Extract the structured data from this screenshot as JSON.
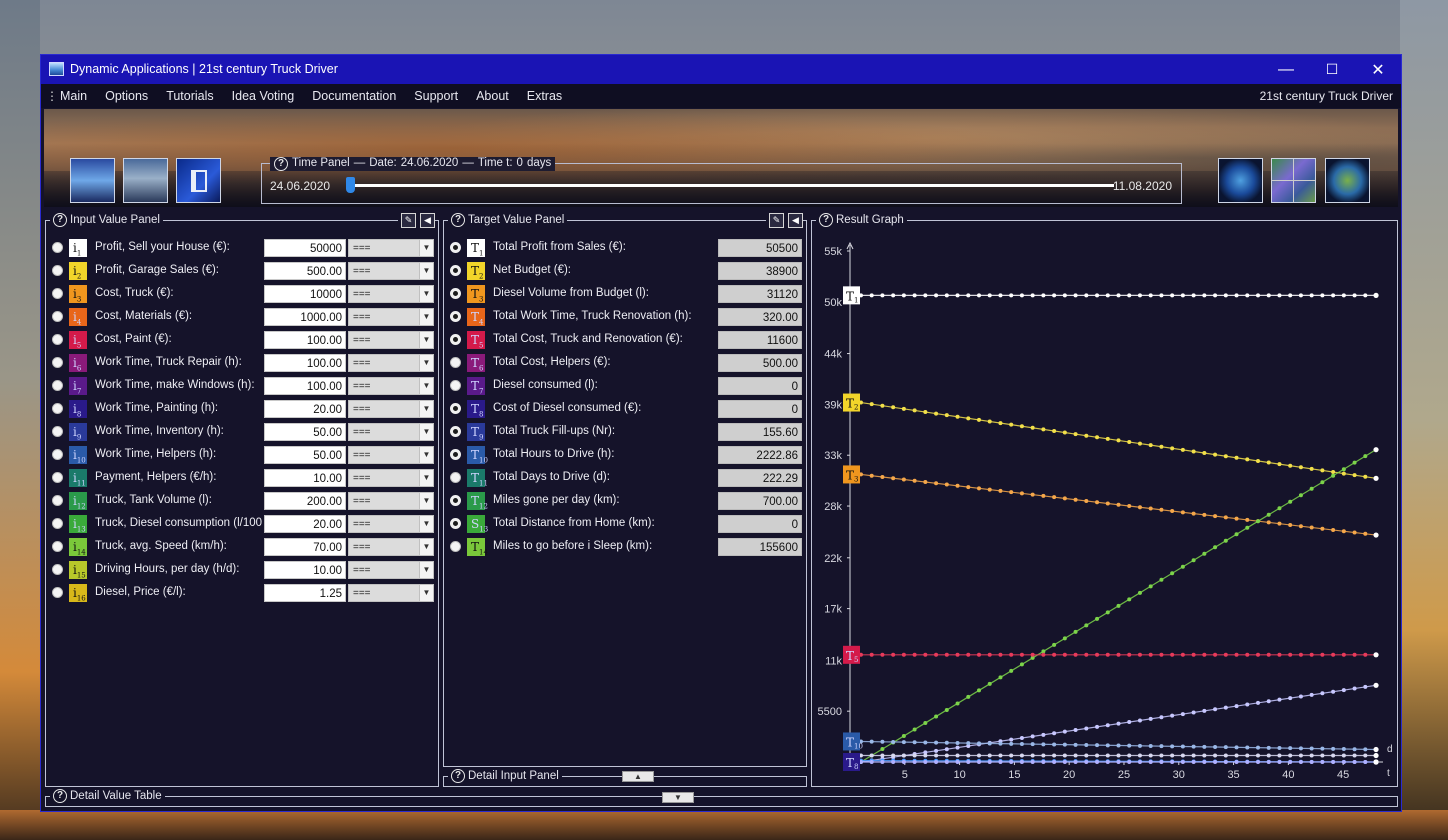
{
  "window": {
    "title": "Dynamic Applications | 21st century Truck Driver",
    "controls": {
      "minimize": "—",
      "maximize": "☐",
      "close": "✕"
    }
  },
  "menu": {
    "items": [
      "Main",
      "Options",
      "Tutorials",
      "Idea Voting",
      "Documentation",
      "Support",
      "About",
      "Extras"
    ],
    "right_label": "21st century Truck Driver"
  },
  "time_panel": {
    "title": "Time Panel",
    "date_label": "Date:",
    "date_value": "24.06.2020",
    "time_label": "Time t:",
    "time_value": "0",
    "time_unit": "days",
    "start_date": "24.06.2020",
    "end_date": "11.08.2020",
    "slider_fraction": 0
  },
  "input_panel": {
    "title": "Input Value Panel",
    "rows": [
      {
        "sym": "i",
        "sub": "1",
        "label": "Profit, Sell your House (€):",
        "value": "50000",
        "op": "===",
        "color": "#ffffff"
      },
      {
        "sym": "i",
        "sub": "2",
        "label": "Profit, Garage Sales (€):",
        "value": "500.00",
        "op": "===",
        "color": "#f2d52a"
      },
      {
        "sym": "i",
        "sub": "3",
        "label": "Cost, Truck (€):",
        "value": "10000",
        "op": "===",
        "color": "#f0961e"
      },
      {
        "sym": "i",
        "sub": "4",
        "label": "Cost, Materials (€):",
        "value": "1000.00",
        "op": "===",
        "color": "#e8661a"
      },
      {
        "sym": "i",
        "sub": "5",
        "label": "Cost, Paint (€):",
        "value": "100.00",
        "op": "===",
        "color": "#d41a4a"
      },
      {
        "sym": "i",
        "sub": "6",
        "label": "Work Time, Truck Repair (h):",
        "value": "100.00",
        "op": "===",
        "color": "#8a1a7a"
      },
      {
        "sym": "i",
        "sub": "7",
        "label": "Work Time, make Windows (h):",
        "value": "100.00",
        "op": "===",
        "color": "#5a1a8a"
      },
      {
        "sym": "i",
        "sub": "8",
        "label": "Work Time, Painting (h):",
        "value": "20.00",
        "op": "===",
        "color": "#2a1a8a"
      },
      {
        "sym": "i",
        "sub": "9",
        "label": "Work Time, Inventory (h):",
        "value": "50.00",
        "op": "===",
        "color": "#2a3a9a"
      },
      {
        "sym": "i",
        "sub": "10",
        "label": "Work Time, Helpers (h):",
        "value": "50.00",
        "op": "===",
        "color": "#2a5aa8"
      },
      {
        "sym": "i",
        "sub": "11",
        "label": "Payment, Helpers (€/h):",
        "value": "10.00",
        "op": "===",
        "color": "#1a7a6a"
      },
      {
        "sym": "i",
        "sub": "12",
        "label": "Truck, Tank Volume (l):",
        "value": "200.00",
        "op": "===",
        "color": "#2a9a4a"
      },
      {
        "sym": "i",
        "sub": "13",
        "label": "Truck, Diesel consumption (l/100 km):",
        "value": "20.00",
        "op": "===",
        "color": "#3aaa3a"
      },
      {
        "sym": "i",
        "sub": "14",
        "label": "Truck, avg. Speed (km/h):",
        "value": "70.00",
        "op": "===",
        "color": "#7ac83a"
      },
      {
        "sym": "i",
        "sub": "15",
        "label": "Driving Hours, per day (h/d):",
        "value": "10.00",
        "op": "===",
        "color": "#b8c82a"
      },
      {
        "sym": "i",
        "sub": "16",
        "label": "Diesel, Price (€/l):",
        "value": "1.25",
        "op": "===",
        "color": "#d8b81a"
      }
    ]
  },
  "target_panel": {
    "title": "Target Value Panel",
    "rows": [
      {
        "sym": "T",
        "sub": "1",
        "label": "Total Profit from Sales (€):",
        "value": "50500",
        "color": "#ffffff",
        "selected": true
      },
      {
        "sym": "T",
        "sub": "2",
        "label": "Net Budget (€):",
        "value": "38900",
        "color": "#f2d52a",
        "selected": true
      },
      {
        "sym": "T",
        "sub": "3",
        "label": "Diesel Volume from Budget (l):",
        "value": "31120",
        "color": "#f0961e",
        "selected": true
      },
      {
        "sym": "T",
        "sub": "4",
        "label": "Total Work Time, Truck Renovation (h):",
        "value": "320.00",
        "color": "#e8661a",
        "selected": true
      },
      {
        "sym": "T",
        "sub": "5",
        "label": "Total Cost, Truck and Renovation (€):",
        "value": "11600",
        "color": "#d41a4a",
        "selected": true
      },
      {
        "sym": "T",
        "sub": "6",
        "label": "Total Cost, Helpers (€):",
        "value": "500.00",
        "color": "#8a1a7a",
        "selected": false
      },
      {
        "sym": "T",
        "sub": "7",
        "label": "Diesel consumed (l):",
        "value": "0",
        "color": "#5a1a8a",
        "selected": false
      },
      {
        "sym": "T",
        "sub": "8",
        "label": "Cost of Diesel consumed (€):",
        "value": "0",
        "color": "#2a1a8a",
        "selected": true
      },
      {
        "sym": "T",
        "sub": "9",
        "label": "Total Truck Fill-ups (Nr):",
        "value": "155.60",
        "color": "#2a3a9a",
        "selected": true
      },
      {
        "sym": "T",
        "sub": "10",
        "label": "Total Hours to Drive (h):",
        "value": "2222.86",
        "color": "#2a5aa8",
        "selected": true
      },
      {
        "sym": "T",
        "sub": "11",
        "label": "Total Days to Drive (d):",
        "value": "222.29",
        "color": "#1a7a6a",
        "selected": false
      },
      {
        "sym": "T",
        "sub": "12",
        "label": "Miles gone per day (km):",
        "value": "700.00",
        "color": "#2a9a4a",
        "selected": true
      },
      {
        "sym": "S",
        "sub": "13",
        "label": "Total Distance from Home (km):",
        "value": "0",
        "color": "#3aaa3a",
        "selected": true
      },
      {
        "sym": "T",
        "sub": "14",
        "label": "Miles to go before i Sleep (km):",
        "value": "155600",
        "color": "#7ac83a",
        "selected": false
      }
    ]
  },
  "detail_input_panel": {
    "title": "Detail Input Panel"
  },
  "detail_value_table": {
    "title": "Detail Value Table"
  },
  "result_graph": {
    "title": "Result Graph",
    "axis_unit_right_top": "d",
    "axis_unit_right_bottom": "t",
    "markers": [
      {
        "sym": "T",
        "sub": "1",
        "color": "#ffffff",
        "y": 50500
      },
      {
        "sym": "T",
        "sub": "2",
        "color": "#f2d52a",
        "y": 38900
      },
      {
        "sym": "T",
        "sub": "3",
        "color": "#f0961e",
        "y": 31120
      },
      {
        "sym": "T",
        "sub": "5",
        "color": "#d41a4a",
        "y": 11600
      },
      {
        "sym": "T",
        "sub": "10",
        "color": "#2a5aa8",
        "y": 2222
      },
      {
        "sym": "T",
        "sub": "8",
        "color": "#2a1a8a",
        "y": 0
      }
    ]
  },
  "chart_data": {
    "type": "line",
    "x": [
      1,
      48
    ],
    "x_ticks": [
      5,
      10,
      15,
      20,
      25,
      30,
      35,
      40,
      45
    ],
    "y_ticks": [
      {
        "value": 5500,
        "label": "5500"
      },
      {
        "value": 11000,
        "label": "11k"
      },
      {
        "value": 16600,
        "label": "17k"
      },
      {
        "value": 22100,
        "label": "22k"
      },
      {
        "value": 27700,
        "label": "28k"
      },
      {
        "value": 33200,
        "label": "33k"
      },
      {
        "value": 38700,
        "label": "39k"
      },
      {
        "value": 44200,
        "label": "44k"
      },
      {
        "value": 49800,
        "label": "50k"
      },
      {
        "value": 55300,
        "label": "55k"
      }
    ],
    "xlim": [
      0,
      49
    ],
    "ylim": [
      0,
      55300
    ],
    "series": [
      {
        "color": "#ffffff",
        "start": 50500,
        "end": 50500
      },
      {
        "color": "#f2e04a",
        "start": 38900,
        "end": 30700
      },
      {
        "color": "#f5a74a",
        "start": 31120,
        "end": 24560
      },
      {
        "color": "#7cd44a",
        "start": 0,
        "end": 33800
      },
      {
        "color": "#e83a5a",
        "start": 11600,
        "end": 11600
      },
      {
        "color": "#c8c8ff",
        "start": 0,
        "end": 8300
      },
      {
        "color": "#9ab8e8",
        "start": 2222,
        "end": 1350
      },
      {
        "color": "#d8d8f0",
        "start": 700,
        "end": 700
      },
      {
        "color": "#4a9aff",
        "start": 155,
        "end": 0
      },
      {
        "color": "#b0b0ff",
        "start": 0,
        "end": 0
      }
    ]
  }
}
